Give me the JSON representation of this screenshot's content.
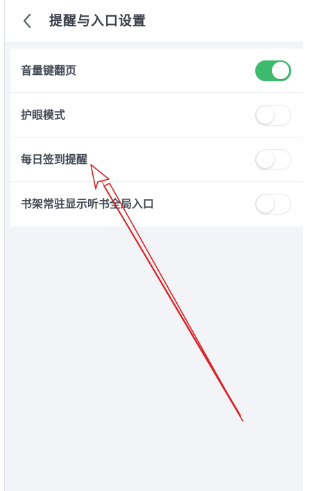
{
  "header": {
    "title": "提醒与入口设置",
    "back_icon": "chevron-left-icon"
  },
  "settings": [
    {
      "label": "音量键翻页",
      "enabled": true
    },
    {
      "label": "护眼模式",
      "enabled": false
    },
    {
      "label": "每日签到提醒",
      "enabled": false
    },
    {
      "label": "书架常驻显示听书全局入口",
      "enabled": false
    }
  ],
  "colors": {
    "toggle_on": "#3dbb6c",
    "background": "#f3f4f8",
    "annotation_arrow": "#d62020"
  }
}
